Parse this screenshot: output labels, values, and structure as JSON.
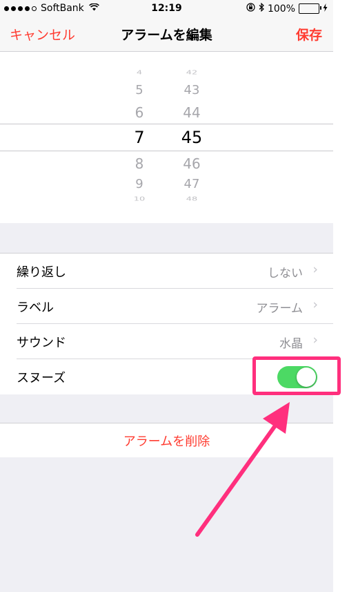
{
  "status_bar": {
    "carrier": "SoftBank",
    "wifi_icon": "wifi-icon",
    "time": "12:19",
    "battery": "100%",
    "battery_level": 1.0,
    "signal_bars": 4
  },
  "nav": {
    "cancel_label": "キャンセル",
    "title": "アラームを編集",
    "save_label": "保存"
  },
  "picker": {
    "hours": [
      "4",
      "5",
      "6",
      "7",
      "8",
      "9",
      "10"
    ],
    "minutes": [
      "42",
      "43",
      "44",
      "45",
      "46",
      "47",
      "48"
    ],
    "selected_hour": "7",
    "selected_minute": "45"
  },
  "settings": {
    "repeat": {
      "label": "繰り返し",
      "value": "しない"
    },
    "label": {
      "label": "ラベル",
      "value": "アラーム"
    },
    "sound": {
      "label": "サウンド",
      "value": "水晶"
    },
    "snooze": {
      "label": "スヌーズ",
      "on": true
    }
  },
  "delete_label": "アラームを削除",
  "colors": {
    "accent": "#ff3b30",
    "toggle_on": "#4cd964",
    "highlight": "#ff2f7d"
  }
}
